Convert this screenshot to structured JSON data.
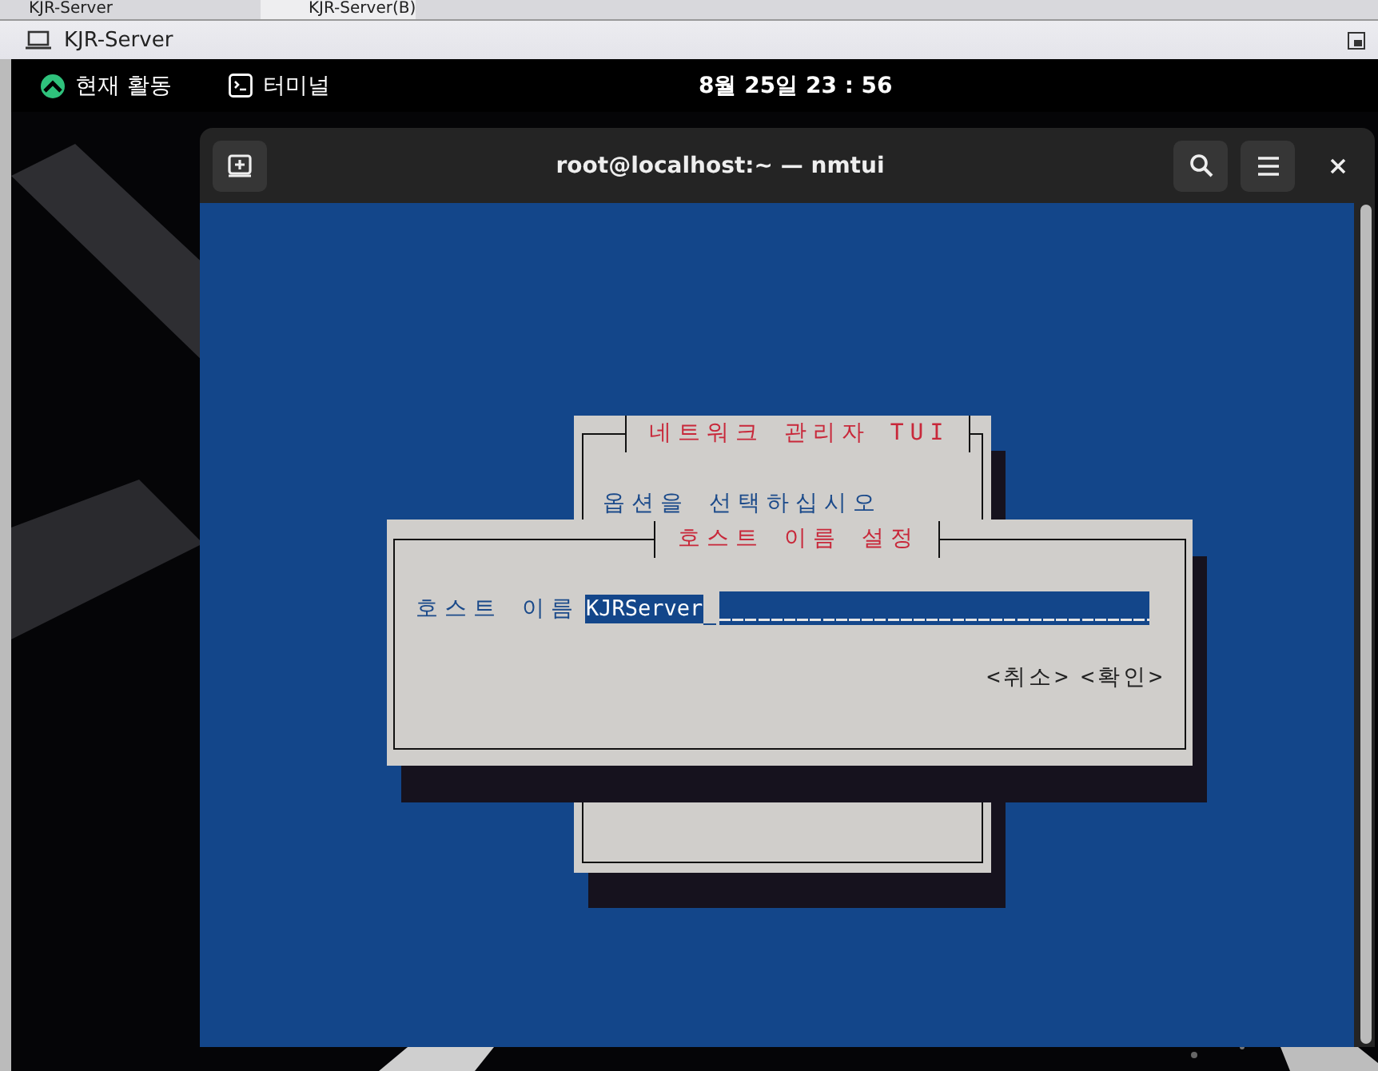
{
  "host_tabs": [
    {
      "label": "KJR-Server"
    },
    {
      "label": "KJR-Server(B)"
    }
  ],
  "vm_window": {
    "title": "KJR-Server"
  },
  "top_bar": {
    "activities": "현재 활동",
    "app": "터미널",
    "clock": "8월 25일 23 : 56"
  },
  "terminal": {
    "title": "root@localhost:~ — nmtui"
  },
  "main_dialog": {
    "title": "네트워크 관리자 TUI",
    "prompt": "옵션을 선택하십시오"
  },
  "hostname_dialog": {
    "title": "호스트 이름 설정",
    "label": "호스트 이름",
    "value": "KJRServer",
    "buttons": [
      {
        "label": "<취소>"
      },
      {
        "label": "<확인>"
      }
    ]
  }
}
